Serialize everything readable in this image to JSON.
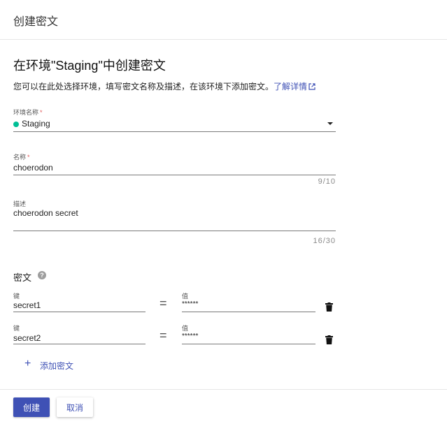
{
  "header": {
    "title": "创建密文"
  },
  "page": {
    "title": "在环境\"Staging\"中创建密文",
    "description": "您可以在此处选择环境，填写密文名称及描述，在该环境下添加密文。",
    "learn_more": "了解详情"
  },
  "form": {
    "environment": {
      "label": "环境名称",
      "required_mark": "*",
      "value": "Staging",
      "status_color": "#00bf96"
    },
    "name": {
      "label": "名称",
      "required_mark": "*",
      "value": "choerodon",
      "counter": "9/10"
    },
    "description": {
      "label": "描述",
      "value": "choerodon secret",
      "counter": "16/30"
    }
  },
  "secrets": {
    "title": "密文",
    "rows": [
      {
        "key_label": "键",
        "key": "secret1",
        "value_label": "值",
        "value": "******"
      },
      {
        "key_label": "键",
        "key": "secret2",
        "value_label": "值",
        "value": "******"
      }
    ],
    "equals": "=",
    "add_label": "添加密文"
  },
  "footer": {
    "create_label": "创建",
    "cancel_label": "取消"
  },
  "colors": {
    "accent": "#3f51b5",
    "required": "#e15b5b"
  }
}
